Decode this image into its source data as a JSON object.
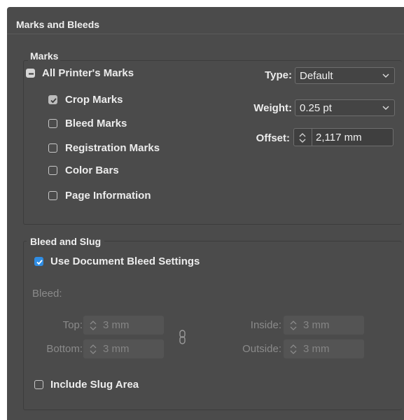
{
  "dialog": {
    "section_title": "Marks and Bleeds"
  },
  "marks": {
    "group_title": "Marks",
    "all_printers_marks": {
      "label": "All Printer's Marks",
      "state": "mixed"
    },
    "items": [
      {
        "label": "Crop Marks",
        "checked": true
      },
      {
        "label": "Bleed Marks",
        "checked": false
      },
      {
        "label": "Registration Marks",
        "checked": false
      },
      {
        "label": "Color Bars",
        "checked": false
      },
      {
        "label": "Page Information",
        "checked": false
      }
    ],
    "type_label": "Type:",
    "type_value": "Default",
    "weight_label": "Weight:",
    "weight_value": "0.25 pt",
    "offset_label": "Offset:",
    "offset_value": "2,117 mm"
  },
  "bleed_slug": {
    "group_title": "Bleed and Slug",
    "use_document_bleed": {
      "label": "Use Document Bleed Settings",
      "checked": true
    },
    "bleed_label": "Bleed:",
    "top_label": "Top:",
    "top_value": "3 mm",
    "bottom_label": "Bottom:",
    "bottom_value": "3 mm",
    "inside_label": "Inside:",
    "inside_value": "3 mm",
    "outside_label": "Outside:",
    "outside_value": "3 mm",
    "include_slug": {
      "label": "Include Slug Area",
      "checked": false
    }
  },
  "colors": {
    "panel_bg": "#4b4b4b",
    "accent_blue": "#2f8de4",
    "text": "#ececec",
    "disabled_text": "#8a8a8a"
  },
  "icons": {
    "dropdown": "chevron-down-icon",
    "stepper": "stepper-arrows-icon",
    "link": "chain-link-icon",
    "check": "checkmark-icon"
  }
}
